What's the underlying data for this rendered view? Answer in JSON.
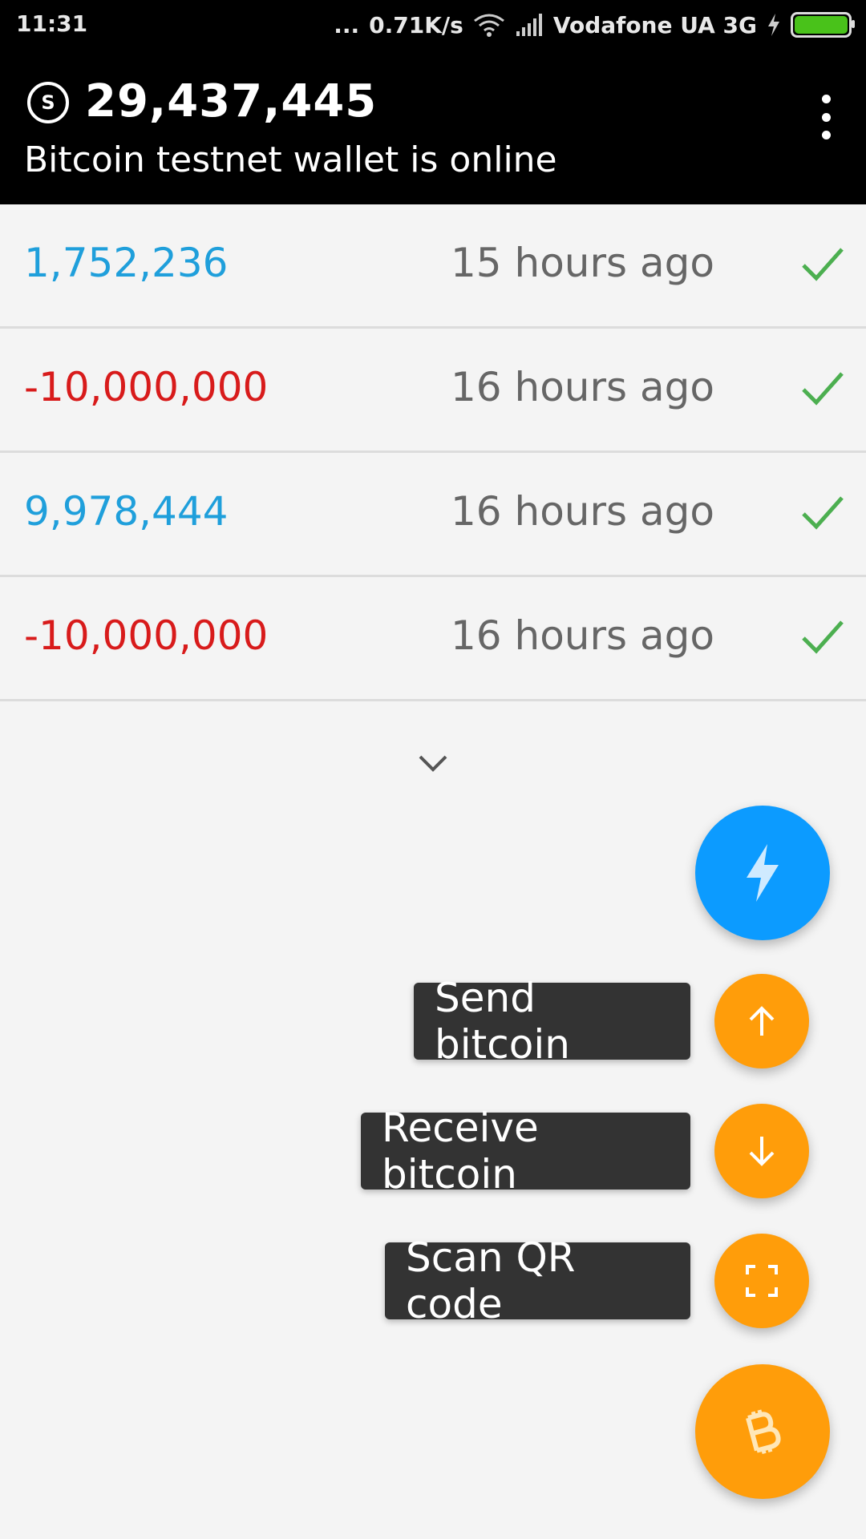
{
  "status_bar": {
    "time": "11:31",
    "dots": "...",
    "network_speed": "0.71K/s",
    "carrier": "Vodafone UA 3G",
    "battery_color": "#49c21a"
  },
  "header": {
    "currency_icon": "S",
    "balance": "29,437,445",
    "status": "Bitcoin testnet wallet is online"
  },
  "transactions": [
    {
      "amount": "1,752,236",
      "time": "15 hours ago",
      "color": "#1f9fdb"
    },
    {
      "amount": "-10,000,000",
      "time": "16 hours ago",
      "color": "#d81b1b"
    },
    {
      "amount": "9,978,444",
      "time": "16 hours ago",
      "color": "#1f9fdb"
    },
    {
      "amount": "-10,000,000",
      "time": "16 hours ago",
      "color": "#d81b1b"
    }
  ],
  "actions": {
    "send_label": "Send bitcoin",
    "receive_label": "Receive bitcoin",
    "scan_label": "Scan QR code"
  },
  "colors": {
    "main_fab": "#0c9bff",
    "mini_fab": "#ff9d0a",
    "check": "#4caf50"
  }
}
